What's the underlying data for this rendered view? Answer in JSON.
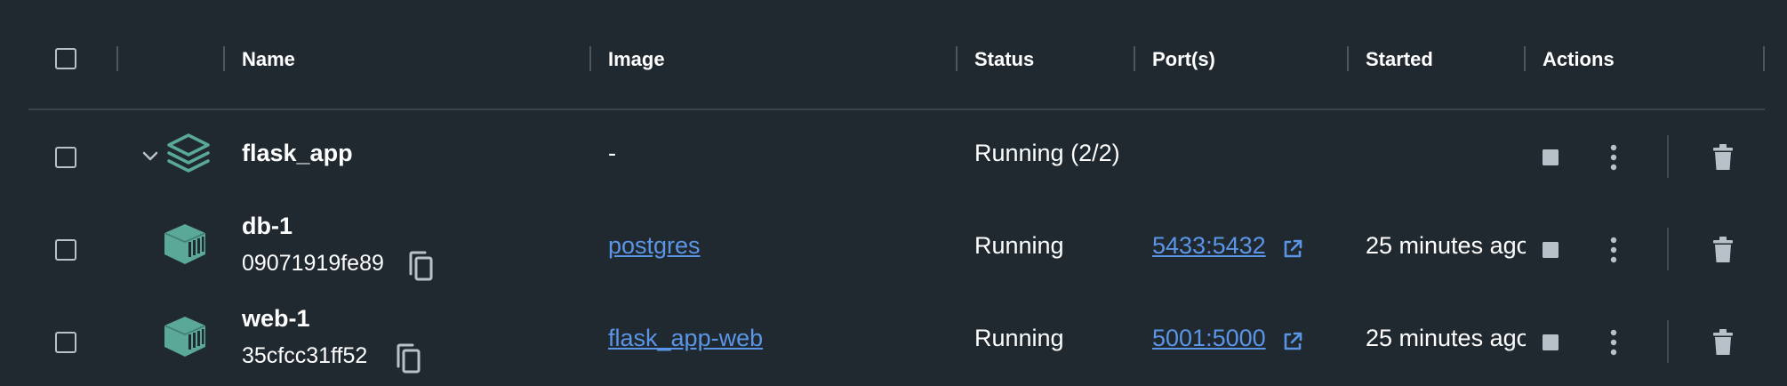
{
  "columns": {
    "name": "Name",
    "image": "Image",
    "status": "Status",
    "ports": "Port(s)",
    "started": "Started",
    "actions": "Actions"
  },
  "colors": {
    "background": "#202830",
    "accent_teal": "#5aa897",
    "link_blue": "#5b95e6",
    "icon_gray": "#b8c0c9"
  },
  "group": {
    "name": "flask_app",
    "image": "-",
    "status": "Running (2/2)",
    "icon": "stack-icon",
    "expanded": true
  },
  "containers": [
    {
      "name": "db-1",
      "id": "09071919fe89",
      "image": "postgres",
      "status": "Running",
      "ports": "5433:5432",
      "started": "25 minutes ago",
      "icon": "container-icon"
    },
    {
      "name": "web-1",
      "id": "35cfcc31ff52",
      "image": "flask_app-web",
      "status": "Running",
      "ports": "5001:5000",
      "started": "25 minutes ago",
      "icon": "container-icon"
    }
  ]
}
